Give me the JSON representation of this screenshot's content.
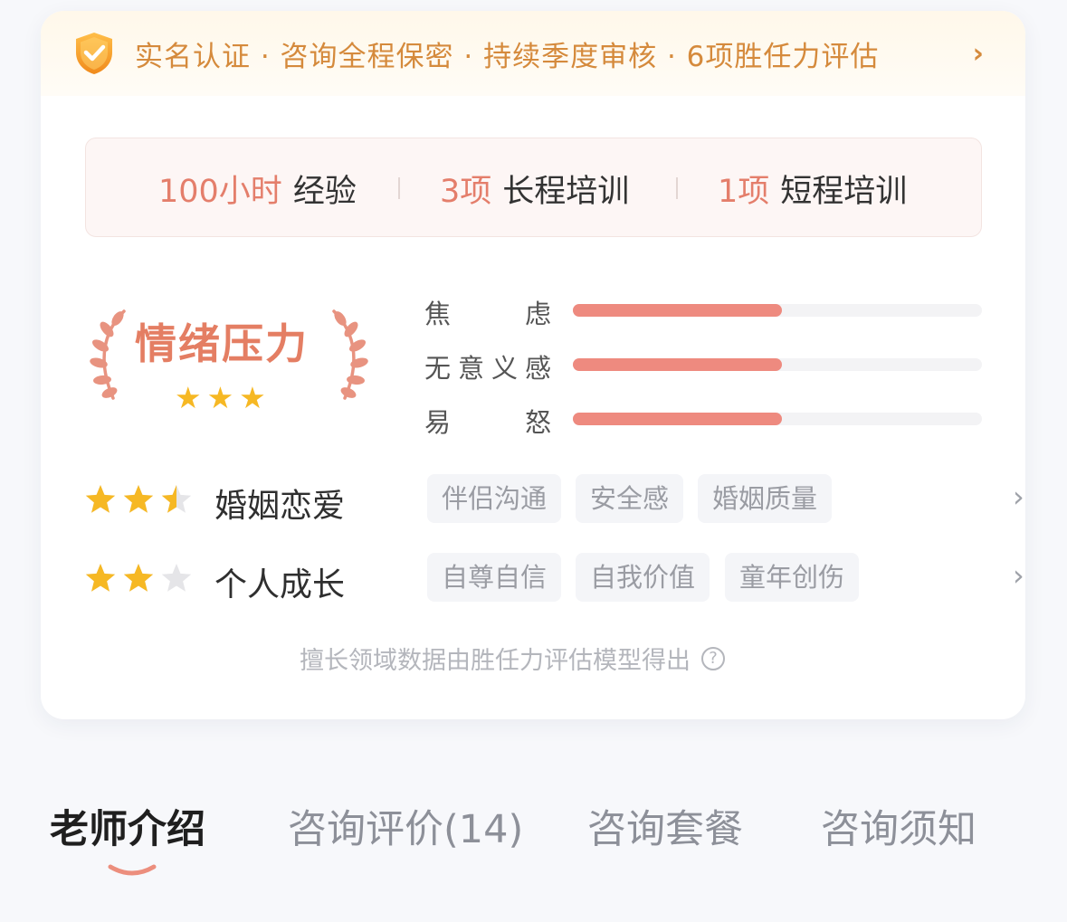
{
  "certification": {
    "text": "实名认证 · 咨询全程保密 · 持续季度审核 · 6项胜任力评估",
    "icon": "shield-check-icon",
    "chevron": "›",
    "colors": {
      "text": "#d58a3c",
      "background": "#fff8ea"
    }
  },
  "stats": [
    {
      "value": "100小时",
      "label": "经验"
    },
    {
      "value": "3项",
      "label": "长程培训"
    },
    {
      "value": "1项",
      "label": "短程培训"
    }
  ],
  "featured": {
    "title": "情绪压力",
    "stars": "★★★",
    "rating": 3,
    "bars": [
      {
        "label_chars": [
          "焦",
          "虑"
        ],
        "level": 0.51
      },
      {
        "label_chars": [
          "无",
          "意",
          "义",
          "感"
        ],
        "level": 0.51
      },
      {
        "label_chars": [
          "易",
          "怒"
        ],
        "level": 0.51
      }
    ]
  },
  "categories": [
    {
      "name": "婚姻恋爱",
      "rating": 2.5,
      "tags": [
        "伴侣沟通",
        "安全感",
        "婚姻质量"
      ],
      "chevron": "›"
    },
    {
      "name": "个人成长",
      "rating": 2,
      "tags": [
        "自尊自信",
        "自我价值",
        "童年创伤"
      ],
      "chevron": "›"
    }
  ],
  "footnote": {
    "text": "擅长领域数据由胜任力评估模型得出",
    "help": "?"
  },
  "tabs": [
    {
      "label": "老师介绍",
      "active": true
    },
    {
      "label": "咨询评价(14)",
      "active": false
    },
    {
      "label": "咨询套餐",
      "active": false
    },
    {
      "label": "咨询须知",
      "active": false
    }
  ],
  "colors": {
    "accent": "#e47e6b",
    "bar": "#ee8a7f",
    "star": "#f6b824",
    "star_empty": "#e5e5e8",
    "tag_bg": "#f4f5f8"
  }
}
